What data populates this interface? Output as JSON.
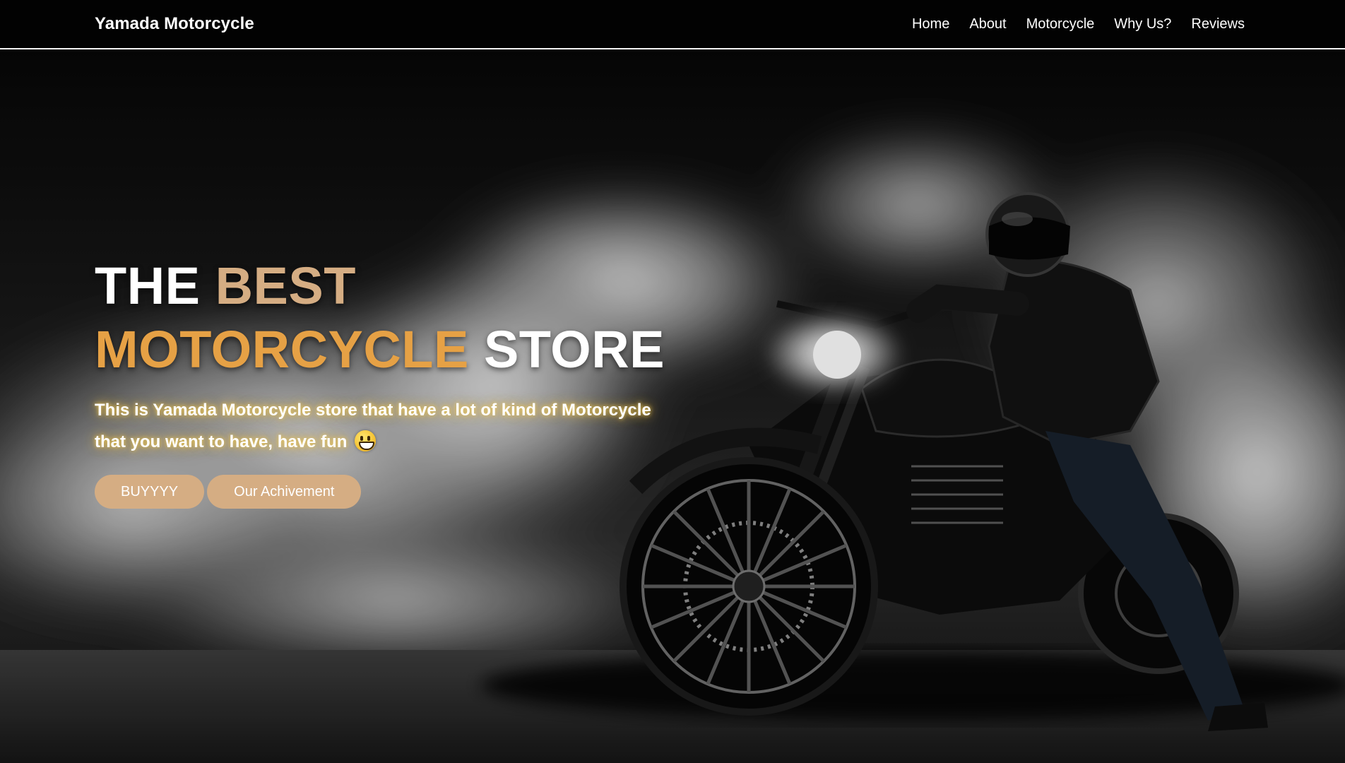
{
  "navbar": {
    "brand": "Yamada Motorcycle",
    "links": [
      "Home",
      "About",
      "Motorcycle",
      "Why Us?",
      "Reviews"
    ]
  },
  "hero": {
    "title": {
      "word1": "THE",
      "word2": "BEST",
      "word3": "MOTORCYCLE",
      "word4": "STORE"
    },
    "description": "This is Yamada Motorcycle store that have a lot of kind of Motorcycle that you want to have, have fun",
    "emoji_icon": "grinning-face-icon",
    "buttons": {
      "buy": "BUYYYY",
      "achievement": "Our Achivement"
    },
    "background_image": "motorcycle-rider-in-smoke-image"
  },
  "colors": {
    "nav_bg": "#020202",
    "accent_tan": "#d5ad83",
    "accent_orange": "#e6a145",
    "text": "#ffffff"
  }
}
